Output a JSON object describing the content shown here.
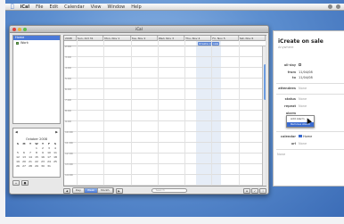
{
  "menubar": {
    "app": "iCal",
    "items": [
      "File",
      "Edit",
      "Calendar",
      "View",
      "Window",
      "Help"
    ]
  },
  "window": {
    "title": "iCal",
    "calendars_header": "Home",
    "calendars": [
      {
        "label": "Work"
      }
    ]
  },
  "minical": {
    "month": "October 2008",
    "weekdays": [
      "S",
      "M",
      "T",
      "W",
      "T",
      "F",
      "S"
    ],
    "days": [
      " ",
      " ",
      " ",
      "1",
      "2",
      "3",
      "4",
      "5",
      "6",
      "7",
      "8",
      "9",
      "10",
      "11",
      "12",
      "13",
      "14",
      "15",
      "16",
      "17",
      "18",
      "19",
      "20",
      "21",
      "22",
      "23",
      "24",
      "25",
      "26",
      "27",
      "28",
      "29",
      "30",
      "31",
      " "
    ]
  },
  "week": {
    "days": [
      "2008",
      "Sun, Oct 31",
      "Mon, Nov 1",
      "Tue, Nov 2",
      "Wed, Nov 3",
      "Thu, Nov 4",
      "Fri, Nov 5",
      "Sat, Nov 6"
    ],
    "allday_event": "iCreate on sale",
    "hours": [
      "2:00",
      "3:00",
      "4:00",
      "5:00",
      "6:00",
      "7:00",
      "8:00",
      "9:00",
      "10:00",
      "11:00",
      "12:00",
      "13:00",
      "14:00"
    ]
  },
  "bottombar": {
    "day": "Day",
    "week": "Week",
    "month": "Month",
    "search_placeholder": "Search"
  },
  "info": {
    "title": "iCreate on sale",
    "location": "Anywhere",
    "allday_label": "all-day",
    "from_label": "from",
    "from_value": "11/04/08",
    "to_label": "to",
    "to_value": "11/04/08",
    "attendees_label": "attendees",
    "attendees_value": "None",
    "status_label": "status",
    "status_value": "None",
    "repeat_label": "repeat",
    "repeat_value": "None",
    "alarm_label": "alarm",
    "alarm_options": [
      "Add Alarm",
      "Remove Alarm"
    ],
    "calendar_label": "calendar",
    "calendar_value": "Home",
    "url_label": "url",
    "url_value": "None",
    "note": "None"
  }
}
